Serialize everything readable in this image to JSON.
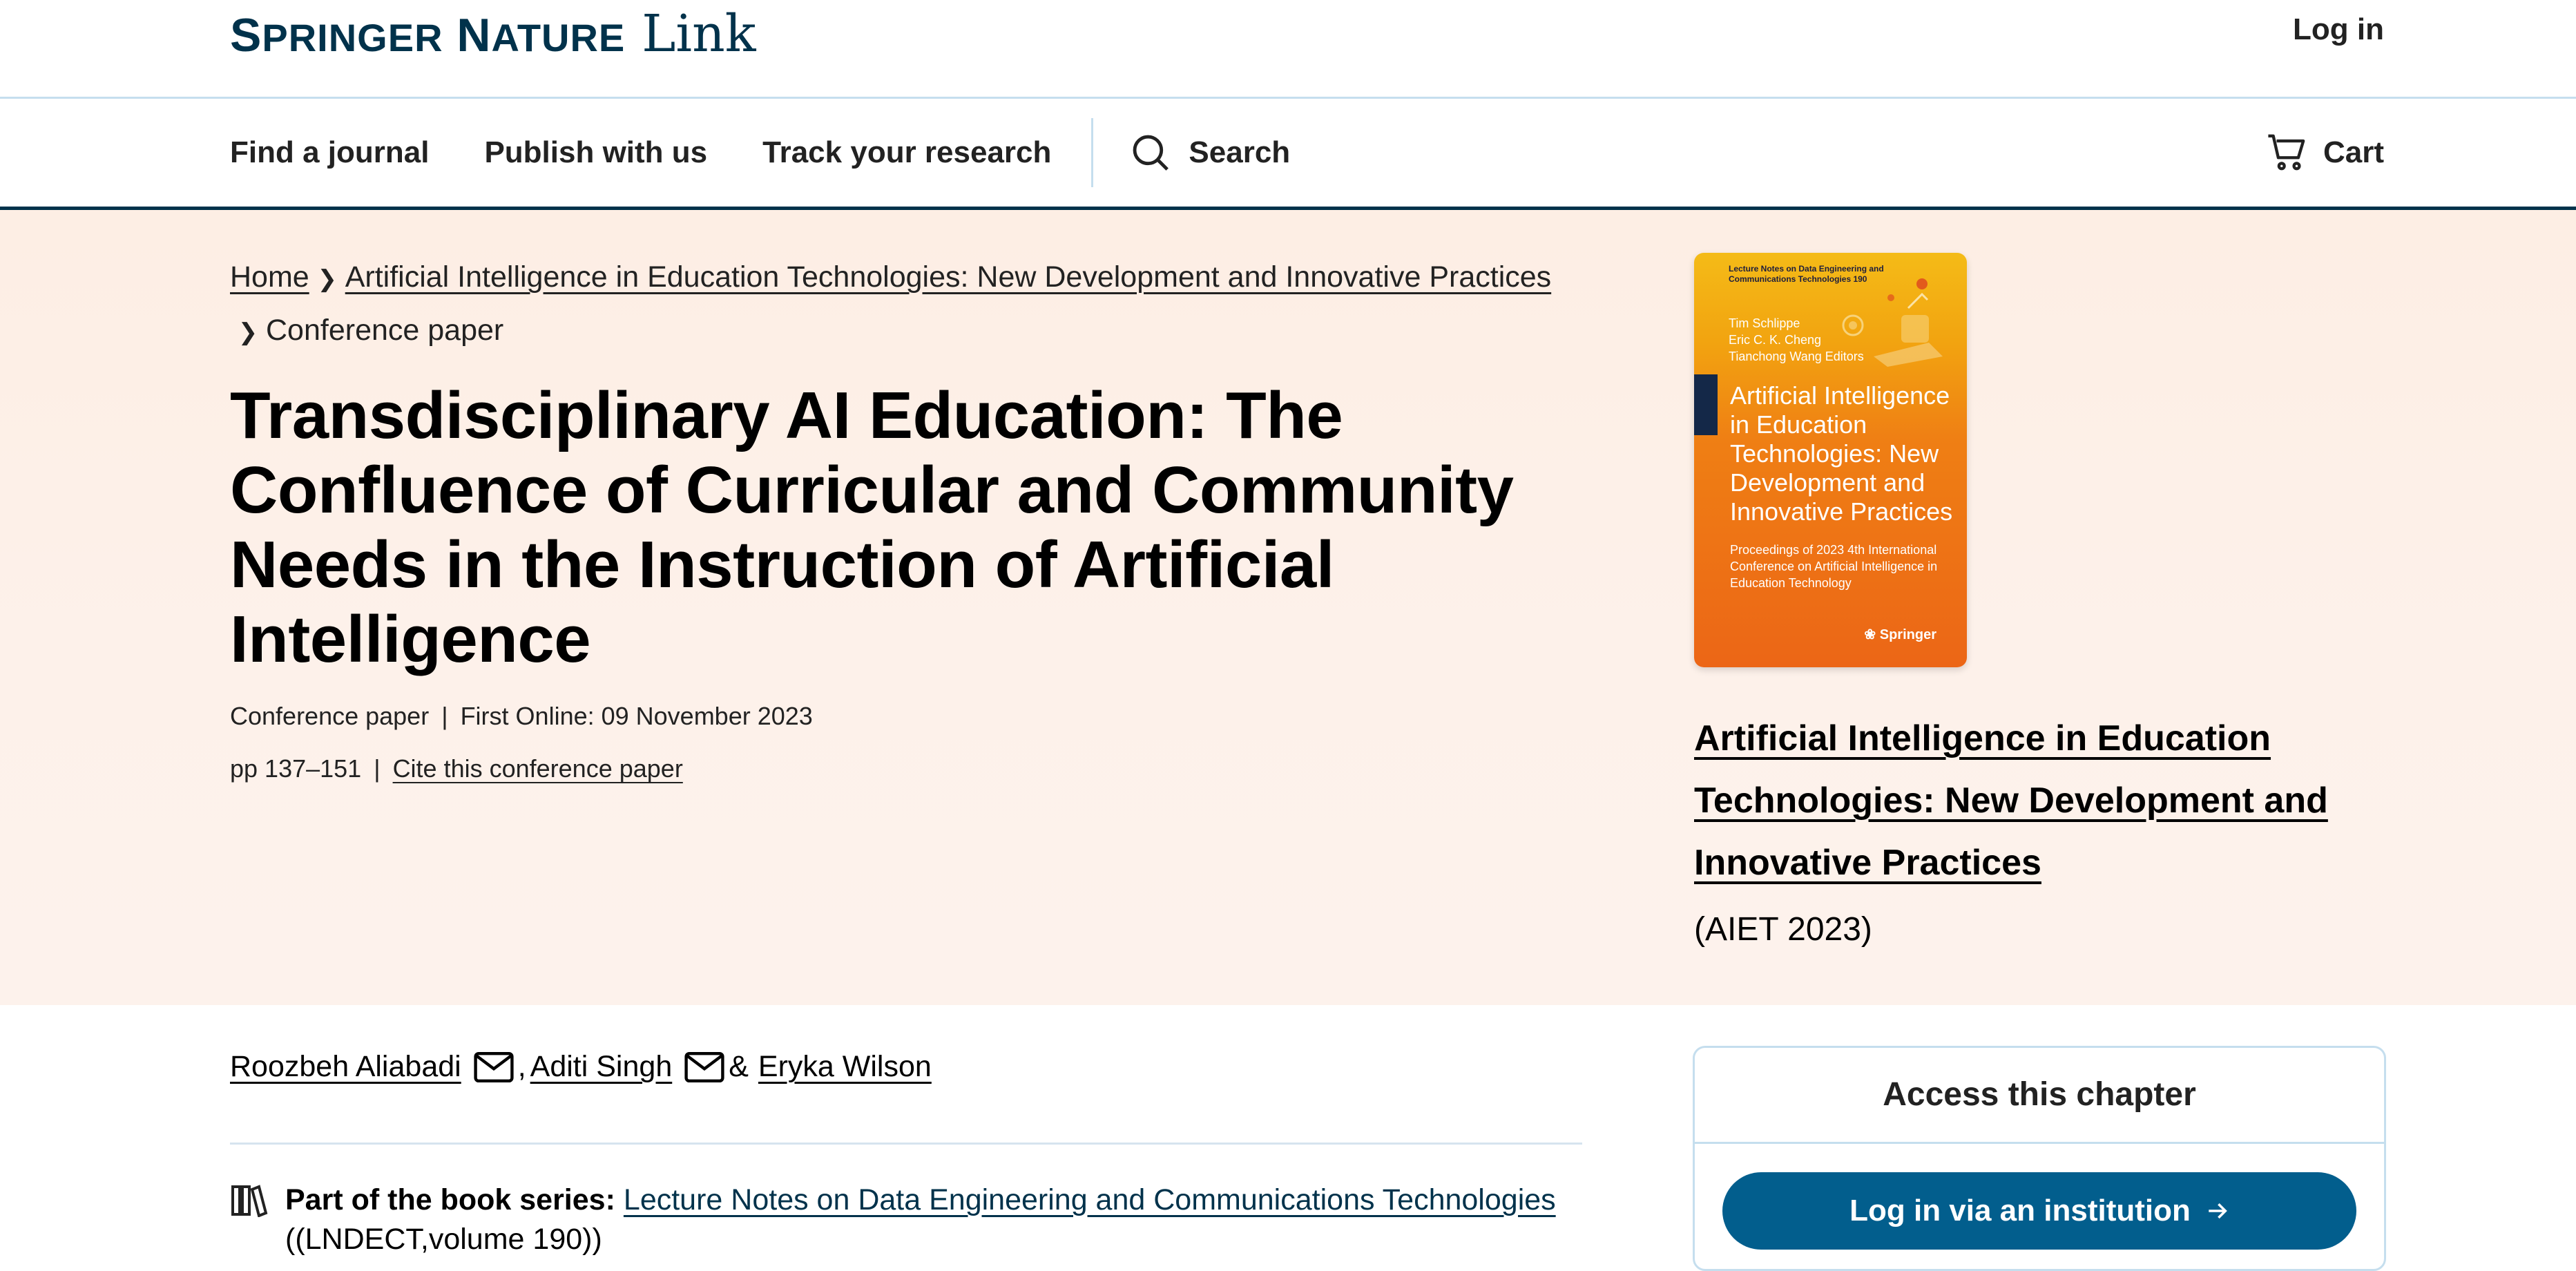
{
  "header": {
    "brand": "Springer Nature",
    "brand_part1_cap": "S",
    "brand_part1_rest": "PRINGER",
    "brand_part2_cap": "N",
    "brand_part2_rest": "ATURE",
    "product": "Link",
    "login_label": "Log in"
  },
  "nav": {
    "items": [
      "Find a journal",
      "Publish with us",
      "Track your research"
    ],
    "search_label": "Search",
    "cart_label": "Cart"
  },
  "breadcrumb": {
    "home": "Home",
    "book": "Artificial Intelligence in Education Technologies: New Development and Innovative Practices",
    "current": "Conference paper"
  },
  "article": {
    "title": "Transdisciplinary AI Education: The Confluence of Curricular and Community Needs in the Instruction of Artificial Intelligence",
    "type": "Conference paper",
    "first_online": "First Online: 09 November 2023",
    "pages": "pp 137–151",
    "cite_label": "Cite this conference paper"
  },
  "book": {
    "title": "Artificial Intelligence in Education Technologies: New Development and Innovative Practices",
    "conference": "(AIET 2023)",
    "cover": {
      "series": "Lecture Notes on Data Engineering and Communications Technologies  190",
      "editors": [
        "Tim Schlippe",
        "Eric C. K. Cheng",
        "Tianchong Wang  Editors"
      ],
      "title": "Artificial Intelligence in Education Technologies: New Development and Innovative Practices",
      "subtitle": "Proceedings of 2023 4th International Conference on Artificial Intelligence in Education Technology",
      "publisher": "Springer"
    }
  },
  "authors": {
    "list": [
      "Roozbeh Aliabadi",
      "Aditi Singh",
      "Eryka Wilson"
    ],
    "separator": ",",
    "conjunction": "&"
  },
  "series": {
    "label": "Part of the book series:",
    "name": "Lecture Notes on Data Engineering and Communications Technologies",
    "volume": "((LNDECT,volume 190))"
  },
  "access": {
    "title": "Access this chapter",
    "button_label": "Log in via an institution"
  },
  "colors": {
    "brand_dark": "#01324b",
    "button_blue": "#025e8d",
    "hero_bg": "#fdeee4",
    "divider": "#c5deee"
  }
}
